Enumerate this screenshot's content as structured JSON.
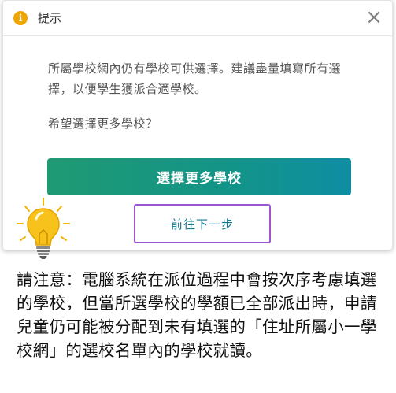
{
  "dialog": {
    "title": "提示",
    "icon": "info-icon",
    "close_label": "×",
    "message": "所屬學校網內仍有學校可供選擇。建議盡量填寫所有選擇，以便學生獲派合適學校。",
    "question": "希望選擇更多學校？",
    "primary_button_label": "選擇更多學校",
    "secondary_button_label": "前往下一步",
    "colors": {
      "icon": "#f0a500",
      "primary_button_start": "#1f9a73",
      "primary_button_end": "#0e8ea2",
      "secondary_button_border": "#9b55d0",
      "secondary_button_text": "#157a8e"
    }
  },
  "note": {
    "icon": "lightbulb-icon",
    "text": "請注意：電腦系統在派位過程中會按次序考慮填選的學校，但當所選學校的學額已全部派出時，申請兒童仍可能被分配到未有填選的「住址所屬小一學校網」的選校名單內的學校就讀。"
  }
}
